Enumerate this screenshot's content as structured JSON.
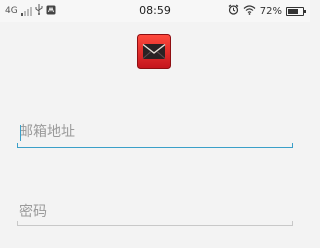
{
  "status_bar": {
    "network": "4G",
    "time": "08:59",
    "battery_percent": "72%",
    "battery_level": 0.72
  },
  "login_form": {
    "email_placeholder": "邮箱地址",
    "email_value": "",
    "password_placeholder": "密码",
    "password_value": "",
    "accent_color": "#3a9fc8"
  },
  "logo": {
    "icon": "envelope-icon",
    "color": "#e52b2b"
  }
}
